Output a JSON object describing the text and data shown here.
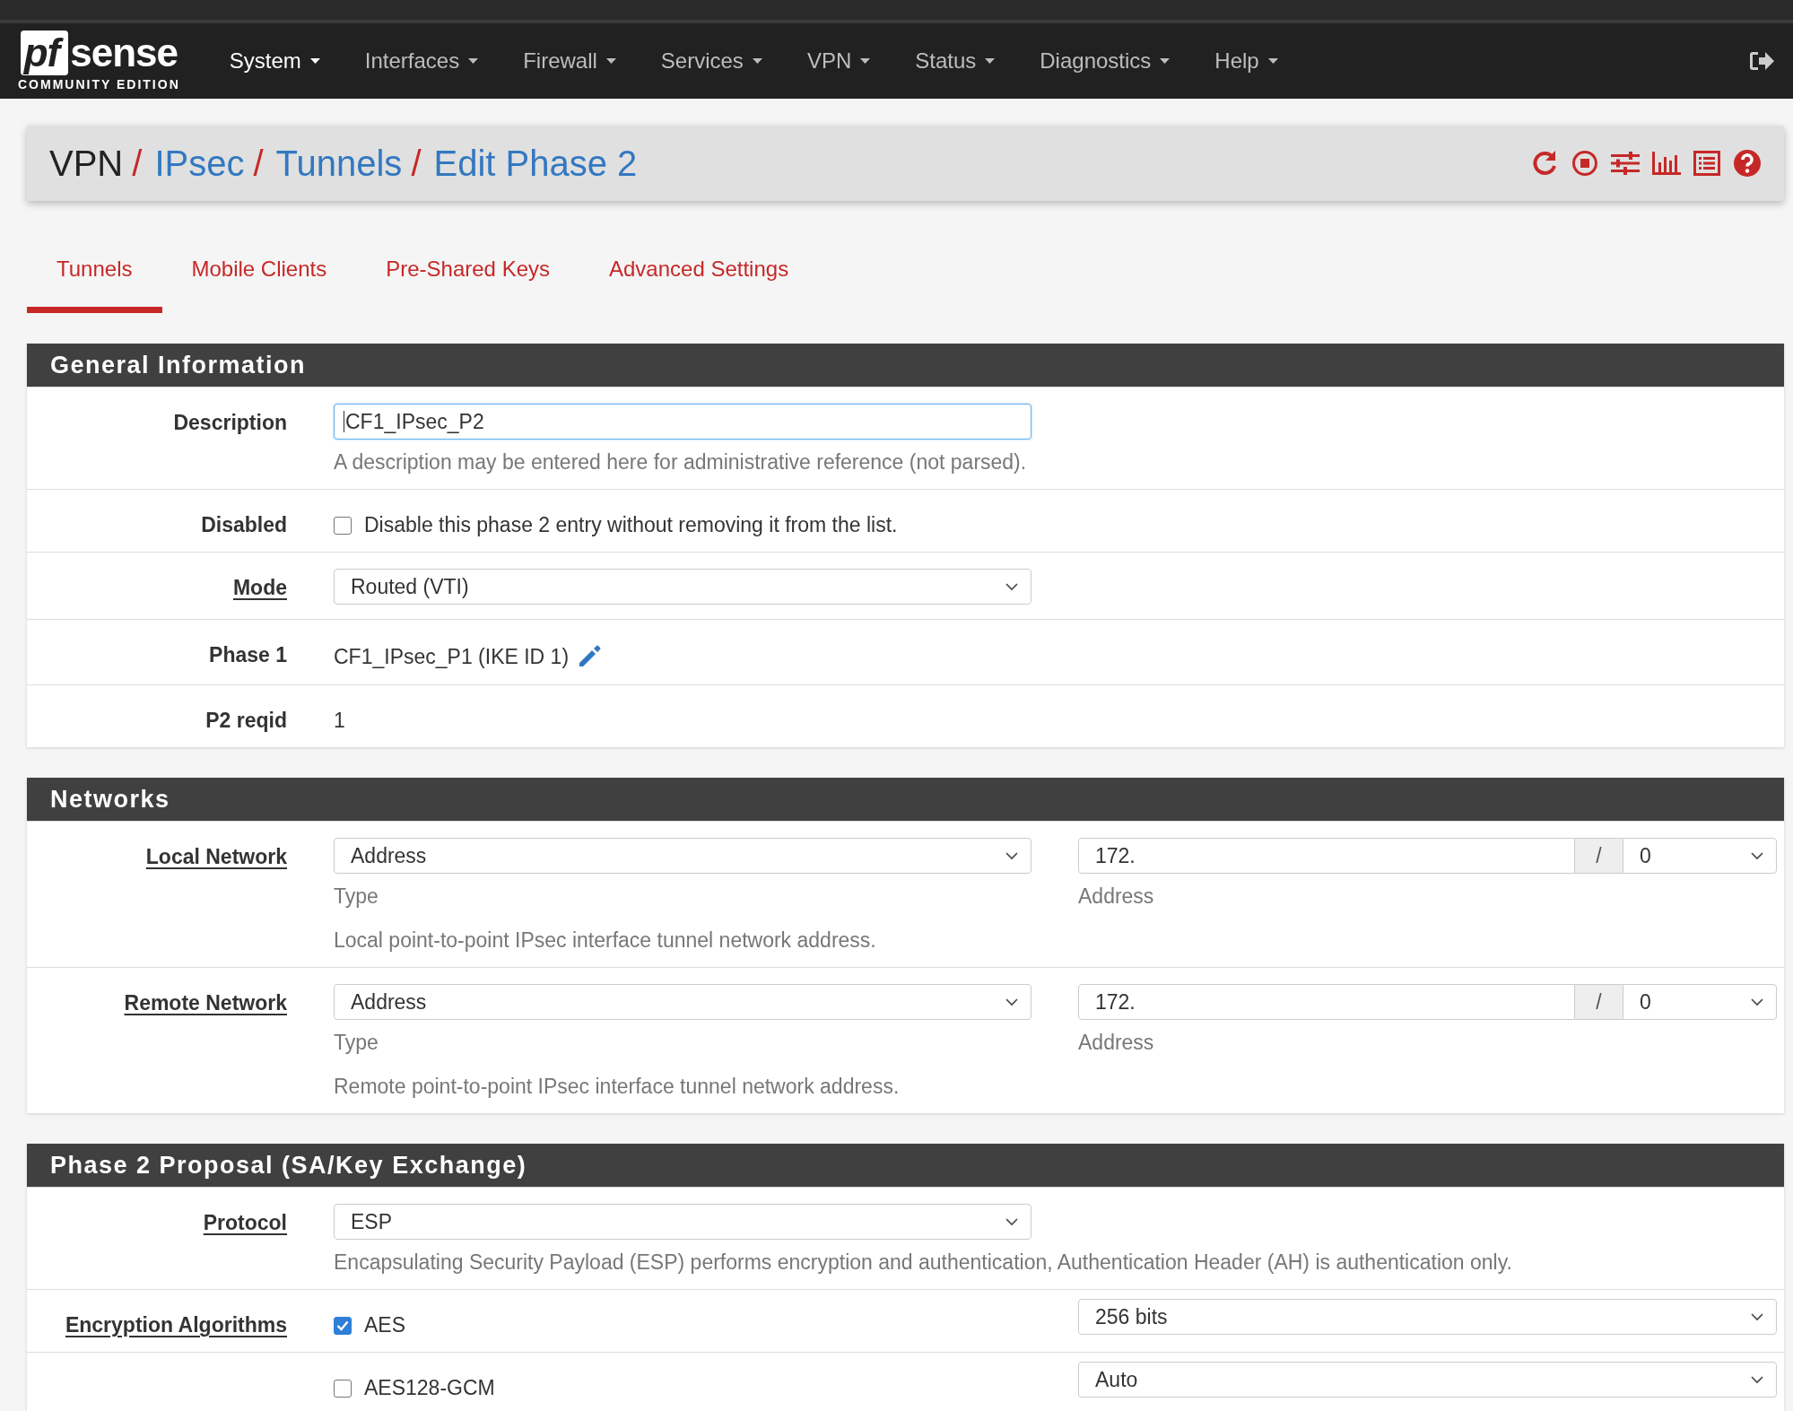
{
  "navbar": {
    "logo": {
      "mark": "pf",
      "name": "sense",
      "edition": "COMMUNITY EDITION"
    },
    "menu": [
      {
        "label": "System",
        "selected": true
      },
      {
        "label": "Interfaces",
        "selected": false
      },
      {
        "label": "Firewall",
        "selected": false
      },
      {
        "label": "Services",
        "selected": false
      },
      {
        "label": "VPN",
        "selected": false
      },
      {
        "label": "Status",
        "selected": false
      },
      {
        "label": "Diagnostics",
        "selected": false
      },
      {
        "label": "Help",
        "selected": false
      }
    ]
  },
  "breadcrumb": [
    {
      "label": "VPN",
      "link": false,
      "separator": "/"
    },
    {
      "label": "IPsec",
      "link": true,
      "separator": "/"
    },
    {
      "label": "Tunnels",
      "link": true,
      "separator": "/"
    },
    {
      "label": "Edit Phase 2",
      "link": true
    }
  ],
  "tabs": [
    {
      "label": "Tunnels",
      "selected": true
    },
    {
      "label": "Mobile Clients",
      "selected": false
    },
    {
      "label": "Pre-Shared Keys",
      "selected": false
    },
    {
      "label": "Advanced Settings",
      "selected": false
    }
  ],
  "sections": [
    {
      "title": "General Information",
      "rows": [
        {
          "kind": "input",
          "label": "Description",
          "label_link": false,
          "value": "CF1_IPsec_P2",
          "focused": true,
          "help": "A description may be entered here for administrative reference (not parsed)."
        },
        {
          "kind": "checkbox",
          "label": "Disabled",
          "label_link": false,
          "checked": false,
          "text": "Disable this phase 2 entry without removing it from the list."
        },
        {
          "kind": "select",
          "label": "Mode",
          "label_link": true,
          "value": "Routed (VTI)"
        },
        {
          "kind": "text",
          "label": "Phase 1",
          "label_link": false,
          "value": "CF1_IPsec_P1 (IKE ID 1)",
          "edit": true
        },
        {
          "kind": "text",
          "label": "P2 reqid",
          "label_link": false,
          "value": "1",
          "edit": false
        }
      ]
    },
    {
      "title": "Networks",
      "rows": [
        {
          "kind": "network",
          "label": "Local Network",
          "label_link": true,
          "type": "Address",
          "type_caption": "Type",
          "address": "172.",
          "address_caption": "Address",
          "slash": "/",
          "mask": "0",
          "help": "Local point-to-point IPsec interface tunnel network address."
        },
        {
          "kind": "network",
          "label": "Remote Network",
          "label_link": true,
          "type": "Address",
          "type_caption": "Type",
          "address": "172.",
          "address_caption": "Address",
          "slash": "/",
          "mask": "0",
          "help": "Remote point-to-point IPsec interface tunnel network address."
        }
      ]
    },
    {
      "title": "Phase 2 Proposal (SA/Key Exchange)",
      "rows": [
        {
          "kind": "select",
          "label": "Protocol",
          "label_link": true,
          "value": "ESP",
          "help": "Encapsulating Security Payload (ESP) performs encryption and authentication, Authentication Header (AH) is authentication only."
        },
        {
          "kind": "algorithm",
          "label": "Encryption Algorithms",
          "label_link": true,
          "checked": true,
          "text": "AES",
          "option": "256 bits"
        },
        {
          "kind": "algorithm",
          "checked": false,
          "text": "AES128-GCM",
          "option": "Auto"
        }
      ]
    }
  ]
}
